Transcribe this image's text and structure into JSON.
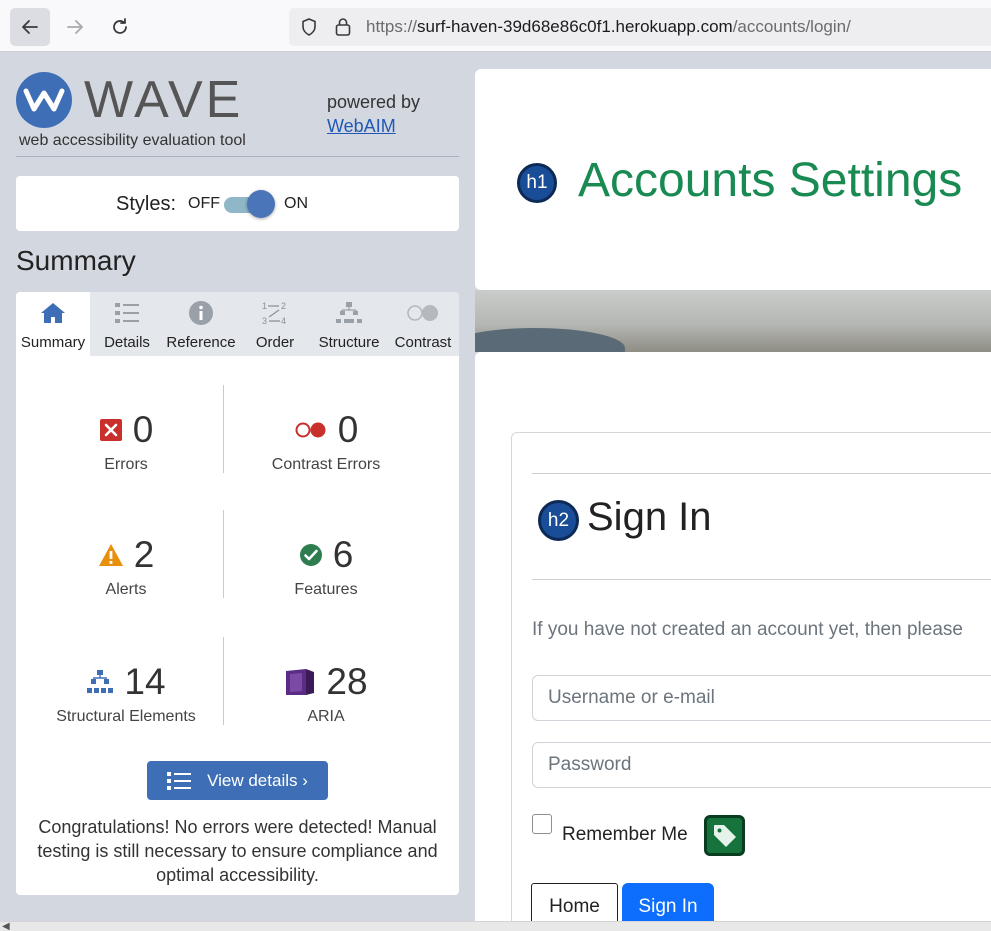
{
  "browser": {
    "url_scheme": "https://",
    "url_host": "surf-haven-39d68e86c0f1.herokuapp.com",
    "url_path": "/accounts/login/"
  },
  "wave": {
    "title": "WAVE",
    "tagline": "web accessibility evaluation tool",
    "powered_by": "powered by",
    "webaim_link": "WebAIM",
    "styles_label": "Styles:",
    "toggle_off": "OFF",
    "toggle_on": "ON",
    "summary_heading": "Summary",
    "tabs": [
      {
        "label": "Summary",
        "icon": "home-icon"
      },
      {
        "label": "Details",
        "icon": "list-icon"
      },
      {
        "label": "Reference",
        "icon": "info-icon"
      },
      {
        "label": "Order",
        "icon": "order-icon"
      },
      {
        "label": "Structure",
        "icon": "structure-icon"
      },
      {
        "label": "Contrast",
        "icon": "contrast-icon"
      }
    ],
    "stats": [
      {
        "count": "0",
        "label": "Errors",
        "icon": "error-icon"
      },
      {
        "count": "0",
        "label": "Contrast Errors",
        "icon": "contrast-error-icon"
      },
      {
        "count": "2",
        "label": "Alerts",
        "icon": "alert-icon"
      },
      {
        "count": "6",
        "label": "Features",
        "icon": "feature-icon"
      },
      {
        "count": "14",
        "label": "Structural Elements",
        "icon": "structure-icon"
      },
      {
        "count": "28",
        "label": "ARIA",
        "icon": "aria-icon"
      }
    ],
    "view_details": "View details ›",
    "congrats": "Congratulations! No errors were detected! Manual testing is still necessary to ensure compliance and optimal accessibility.",
    "colors": {
      "accent": "#3e6fb6",
      "error": "#c9302c",
      "alert": "#e8900c",
      "feature": "#2e7d4f",
      "aria": "#5b2c83"
    }
  },
  "page": {
    "h1_badge": "h1",
    "title": "Accounts Settings",
    "h2_badge": "h2",
    "sign_in_heading": "Sign In",
    "intro": "If you have not created an account yet, then please",
    "username_placeholder": "Username or e-mail",
    "password_placeholder": "Password",
    "remember_me": "Remember Me",
    "home_button": "Home",
    "sign_in_button": "Sign In",
    "colors": {
      "title": "#188a52",
      "primary": "#0d6efd"
    }
  }
}
